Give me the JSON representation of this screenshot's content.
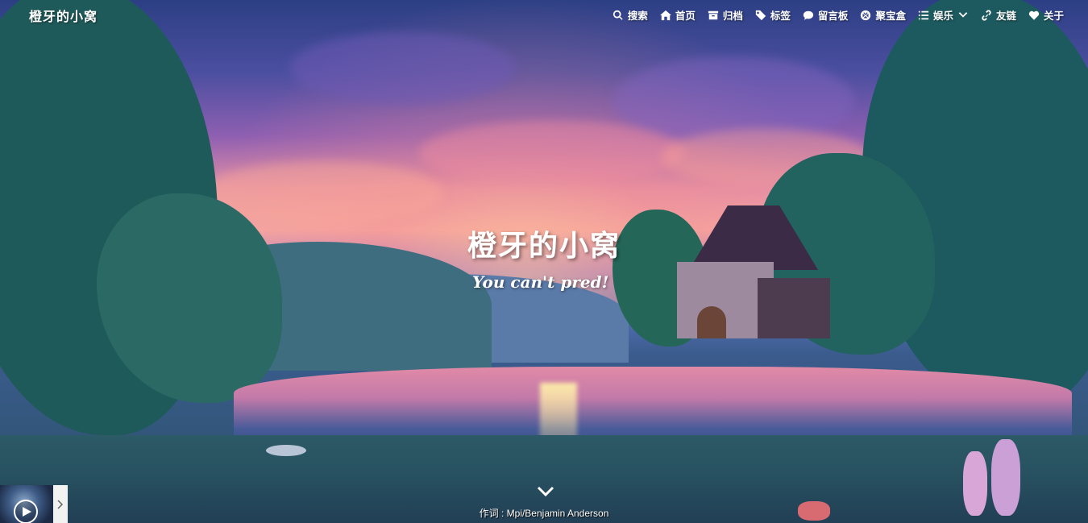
{
  "site": {
    "brand": "橙牙的小窝"
  },
  "nav": {
    "items": [
      {
        "label": "搜索",
        "icon": "search-icon"
      },
      {
        "label": "首页",
        "icon": "home-icon"
      },
      {
        "label": "归档",
        "icon": "archive-icon"
      },
      {
        "label": "标签",
        "icon": "tags-icon"
      },
      {
        "label": "留言板",
        "icon": "comment-icon"
      },
      {
        "label": "聚宝盒",
        "icon": "treasure-box-icon"
      },
      {
        "label": "娱乐",
        "icon": "list-icon"
      },
      {
        "label": "友链",
        "icon": "link-icon"
      },
      {
        "label": "关于",
        "icon": "heart-icon"
      }
    ]
  },
  "hero": {
    "title": "橙牙的小窝",
    "subtitle": "You can't pred!"
  },
  "player": {
    "lyric": "作词 : Mpi/Benjamin Anderson"
  }
}
